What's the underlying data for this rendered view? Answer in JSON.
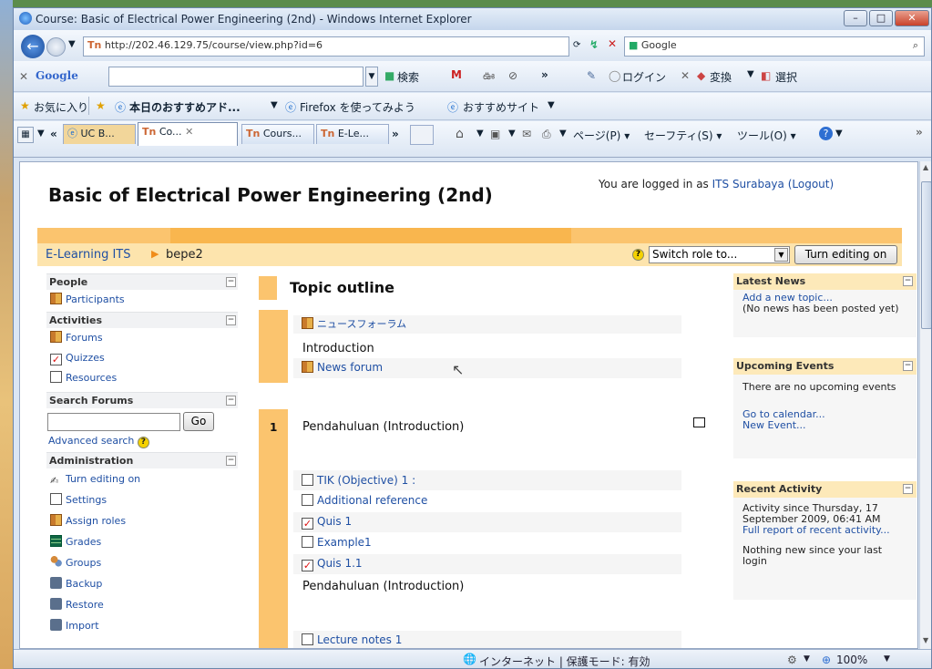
{
  "window": {
    "title": "Course: Basic of Electrical Power Engineering (2nd) - Windows Internet Explorer",
    "address": "http://202.46.129.75/course/view.php?id=6",
    "search_provider": "Google"
  },
  "google_toolbar": {
    "brand": "Google",
    "search_label": "検索",
    "login_label": "ログイン",
    "convert_label": "変換",
    "select_label": "選択"
  },
  "favorites_bar": {
    "favorites_label": "お気に入り",
    "links": [
      "本日のおすすめアド...",
      "Firefox を使ってみよう",
      "おすすめサイト"
    ]
  },
  "tabs": [
    "UC B...",
    "Co...",
    "Cours...",
    "E-Le..."
  ],
  "command_bar": {
    "page_label": "ページ(P)",
    "safety_label": "セーフティ(S)",
    "tools_label": "ツール(O)"
  },
  "page": {
    "course_title": "Basic of Electrical Power Engineering (2nd)",
    "logged_in_prefix": "You are logged in as",
    "user_name": "ITS Surabaya",
    "logout_label": "(Logout)",
    "breadcrumb": [
      "E-Learning ITS",
      "bepe2"
    ],
    "switch_role": "Switch role to...",
    "turn_editing_button": "Turn editing on"
  },
  "left_blocks": {
    "people": {
      "title": "People",
      "items": [
        "Participants"
      ]
    },
    "activities": {
      "title": "Activities",
      "items": [
        "Forums",
        "Quizzes",
        "Resources"
      ]
    },
    "search": {
      "title": "Search Forums",
      "go_label": "Go",
      "advanced_label": "Advanced search"
    },
    "administration": {
      "title": "Administration",
      "items": [
        "Turn editing on",
        "Settings",
        "Assign roles",
        "Grades",
        "Groups",
        "Backup",
        "Restore",
        "Import"
      ]
    }
  },
  "main": {
    "heading": "Topic outline",
    "section0": {
      "forum_jp": "ニュースフォーラム",
      "intro_text": "Introduction",
      "news_forum": "News forum"
    },
    "section1": {
      "number": "1",
      "title": "Pendahuluan (Introduction)",
      "items": [
        "TIK (Objective) 1 :",
        "Additional reference",
        "Quis 1",
        "Example1",
        "Quis 1.1"
      ],
      "summary": "Pendahuluan (Introduction)",
      "last_item": "Lecture notes 1"
    }
  },
  "right_blocks": {
    "latest_news": {
      "title": "Latest News",
      "add_link": "Add a new topic...",
      "empty": "(No news has been posted yet)"
    },
    "upcoming": {
      "title": "Upcoming Events",
      "empty": "There are no upcoming events",
      "calendar_link": "Go to calendar...",
      "new_event": "New Event..."
    },
    "recent": {
      "title": "Recent Activity",
      "since": "Activity since Thursday, 17 September 2009, 06:41 AM",
      "full_report": "Full report of recent activity...",
      "nothing": "Nothing new since your last login"
    }
  },
  "status_bar": {
    "zone": "インターネット | 保護モード: 有効",
    "zoom": "100%"
  },
  "colors": {
    "moodle_orange": "#fbc46e",
    "link": "#1f4fa3",
    "ie_chrome": "#dbe6f4"
  }
}
